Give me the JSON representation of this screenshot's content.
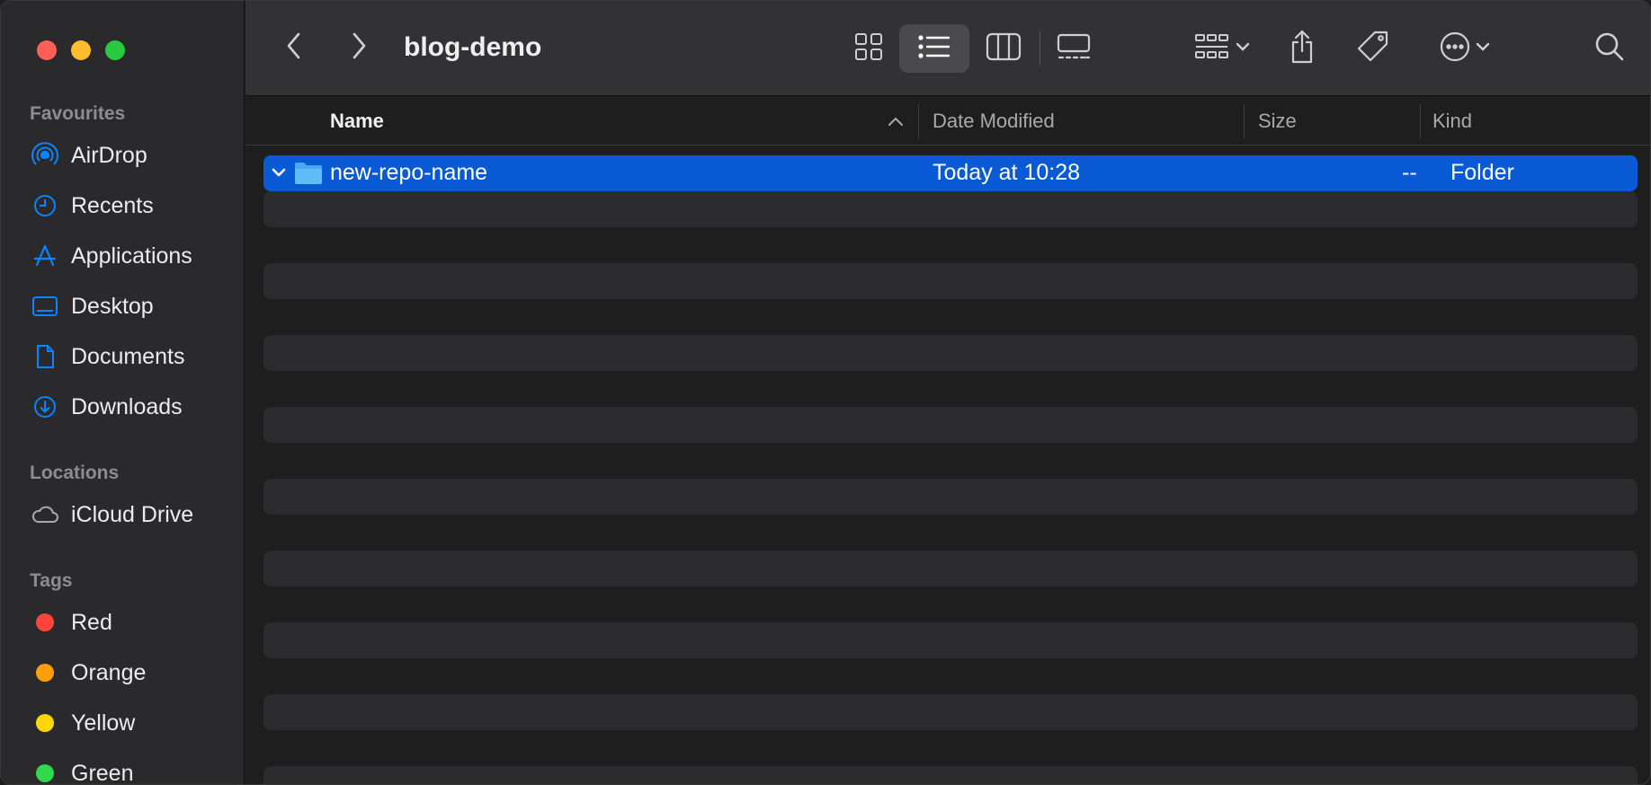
{
  "window": {
    "title": "blog-demo"
  },
  "traffic_lights": {
    "close_color": "#ff5f57",
    "minimize_color": "#febc2e",
    "zoom_color": "#28c840"
  },
  "sidebar": {
    "favourites_title": "Favourites",
    "favourites": [
      {
        "label": "AirDrop",
        "icon": "airdrop-icon"
      },
      {
        "label": "Recents",
        "icon": "clock-icon"
      },
      {
        "label": "Applications",
        "icon": "applications-icon"
      },
      {
        "label": "Desktop",
        "icon": "desktop-icon"
      },
      {
        "label": "Documents",
        "icon": "document-icon"
      },
      {
        "label": "Downloads",
        "icon": "download-icon"
      }
    ],
    "locations_title": "Locations",
    "locations": [
      {
        "label": "iCloud Drive",
        "icon": "cloud-icon"
      }
    ],
    "tags_title": "Tags",
    "tags": [
      {
        "label": "Red",
        "color": "#ff453a"
      },
      {
        "label": "Orange",
        "color": "#ff9f0a"
      },
      {
        "label": "Yellow",
        "color": "#ffd60a"
      },
      {
        "label": "Green",
        "color": "#32d74b"
      }
    ]
  },
  "toolbar": {
    "icons": [
      "back-icon",
      "forward-icon",
      "icon-view-icon",
      "list-view-icon",
      "column-view-icon",
      "gallery-view-icon",
      "group-icon",
      "share-icon",
      "tag-icon",
      "more-icon",
      "search-icon"
    ],
    "active_view": "list"
  },
  "columns": {
    "name": "Name",
    "date_modified": "Date Modified",
    "size": "Size",
    "kind": "Kind",
    "sort_indicator": "^"
  },
  "files": [
    {
      "name": "new-repo-name",
      "date_modified": "Today at 10:28",
      "size": "--",
      "kind": "Folder",
      "selected": true,
      "expanded": true
    }
  ],
  "colors": {
    "selection": "#0a5ad6",
    "accent": "#0a84ff"
  }
}
